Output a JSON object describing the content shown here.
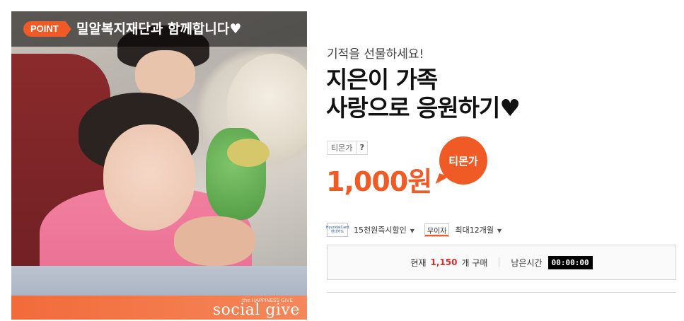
{
  "image_panel": {
    "badge": "POINT",
    "headline": "밀알복지재단과 함께합니다♥",
    "logo_small": "the HAPPINESS GIVE",
    "logo": "social give"
  },
  "product": {
    "subtitle": "기적을 선물하세요!",
    "title_line1": "지은이 가족",
    "title_line2": "사랑으로 응원하기♥",
    "price_label": "티몬가",
    "price_help": "?",
    "price": "1,000원",
    "price_bubble": "티몬가"
  },
  "payment": {
    "card_logo_line1": "HyundaiCard",
    "card_logo_line2": "현대카드",
    "card_discount": "15천원즉시할인",
    "installment_badge": "무이자",
    "installment": "최대12개월"
  },
  "status": {
    "current_label": "현재",
    "count": "1,150",
    "count_unit": "개 구매",
    "remaining_label": "남은시간",
    "timer": "00:00:00"
  },
  "colors": {
    "accent": "#f05a24",
    "count": "#e02b2b"
  }
}
